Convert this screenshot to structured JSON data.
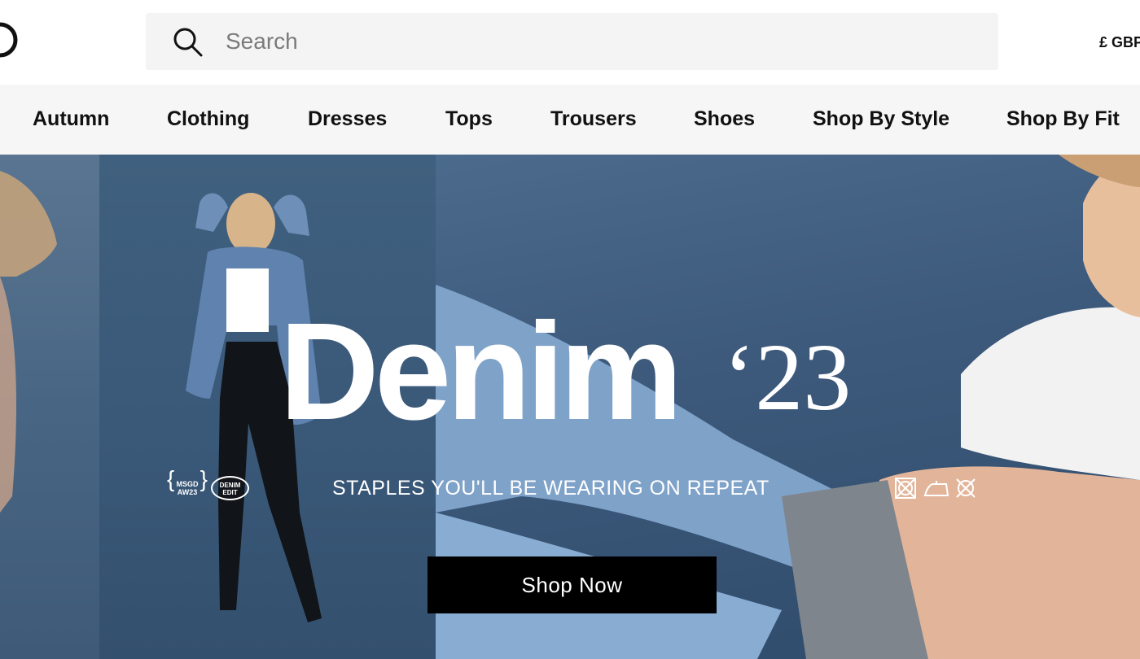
{
  "header": {
    "logo_icon": "brand-logo-fragment",
    "search": {
      "placeholder": "Search",
      "value": "",
      "icon": "search-icon"
    },
    "currency": "£ GBP"
  },
  "nav": {
    "items": [
      {
        "label": "Autumn"
      },
      {
        "label": "Clothing"
      },
      {
        "label": "Dresses"
      },
      {
        "label": "Tops"
      },
      {
        "label": "Trousers"
      },
      {
        "label": "Shoes"
      },
      {
        "label": "Shop By Style"
      },
      {
        "label": "Shop By Fit"
      }
    ]
  },
  "hero": {
    "title": "Denim",
    "year": "‘23",
    "badge_msgd": "MSGD AW23",
    "badge_denim": "DENIM EDIT",
    "subtitle": "STAPLES YOU'LL BE WEARING ON REPEAT",
    "care_icons": [
      "no-tumble-dry-icon",
      "iron-icon",
      "no-wash-icon"
    ],
    "cta_label": "Shop Now"
  },
  "colors": {
    "hero_blue": "#3d5776",
    "cta_bg": "#000000",
    "nav_bg": "#f6f6f6",
    "search_bg": "#f4f4f4"
  }
}
